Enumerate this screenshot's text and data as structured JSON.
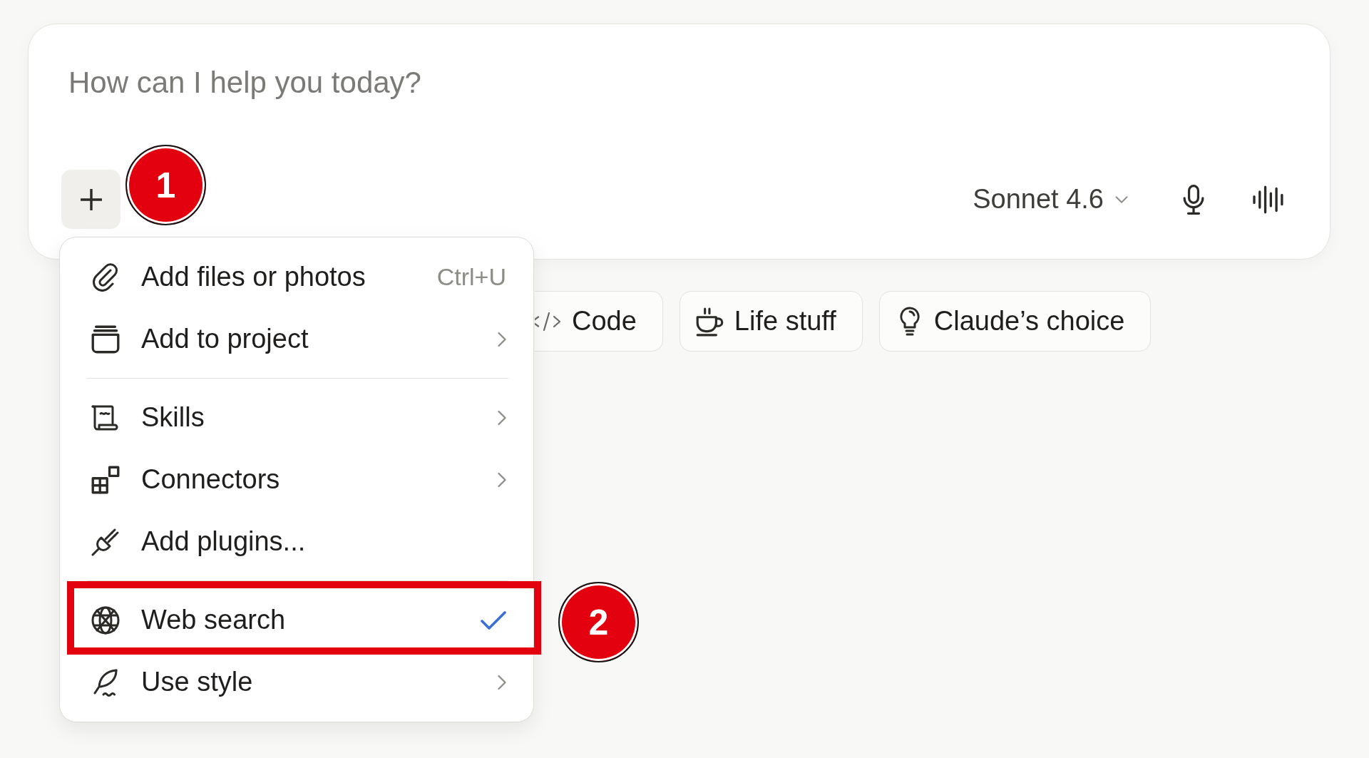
{
  "composer": {
    "placeholder": "How can I help you today?",
    "plus_annotation": "1",
    "model": "Sonnet 4.6"
  },
  "menu": {
    "sections": [
      {
        "items": [
          {
            "label": "Add files or photos",
            "kind": "shortcut",
            "shortcut": "Ctrl+U",
            "checked": false,
            "highlighted": false
          },
          {
            "label": "Add to project",
            "kind": "submenu",
            "checked": false,
            "highlighted": false
          }
        ]
      },
      {
        "items": [
          {
            "label": "Skills",
            "kind": "submenu",
            "checked": false,
            "highlighted": false
          },
          {
            "label": "Connectors",
            "kind": "submenu",
            "checked": false,
            "highlighted": false
          },
          {
            "label": "Add plugins...",
            "kind": "action",
            "checked": false,
            "highlighted": false
          }
        ]
      },
      {
        "items": [
          {
            "label": "Web search",
            "kind": "toggle",
            "checked": true,
            "highlighted": true,
            "annotation": "2"
          },
          {
            "label": "Use style",
            "kind": "submenu",
            "checked": false,
            "highlighted": false
          }
        ]
      }
    ]
  },
  "chips": [
    {
      "label": "Code"
    },
    {
      "label": "Life stuff"
    },
    {
      "label": "Claude’s choice"
    }
  ]
}
